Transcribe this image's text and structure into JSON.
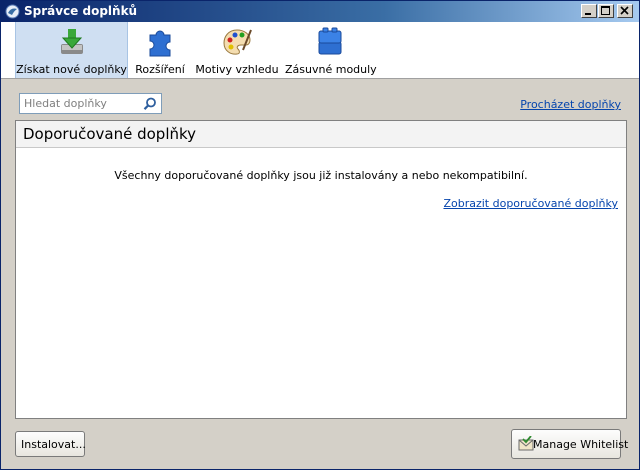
{
  "window": {
    "title": "Správce doplňků"
  },
  "toolbar": {
    "items": [
      {
        "label": "Získat nové doplňky",
        "icon": "download-addons-icon",
        "selected": true
      },
      {
        "label": "Rozšíření",
        "icon": "puzzle-icon",
        "selected": false
      },
      {
        "label": "Motivy vzhledu",
        "icon": "palette-icon",
        "selected": false
      },
      {
        "label": "Zásuvné moduly",
        "icon": "plugin-blocks-icon",
        "selected": false
      }
    ]
  },
  "search": {
    "placeholder": "Hledat doplňky",
    "value": ""
  },
  "browse_link": "Procházet doplňky",
  "panel": {
    "title": "Doporučované doplňky",
    "message": "Všechny doporučované doplňky jsou již instalovány a nebo nekompatibilní.",
    "show_link": "Zobrazit doporučované doplňky"
  },
  "buttons": {
    "install": "Instalovat...",
    "whitelist": "Manage Whitelist"
  },
  "colors": {
    "title_bar": "#0a246a",
    "link": "#0645ad",
    "selected_tab": "#cfdff2",
    "chrome": "#d4d0c8"
  }
}
